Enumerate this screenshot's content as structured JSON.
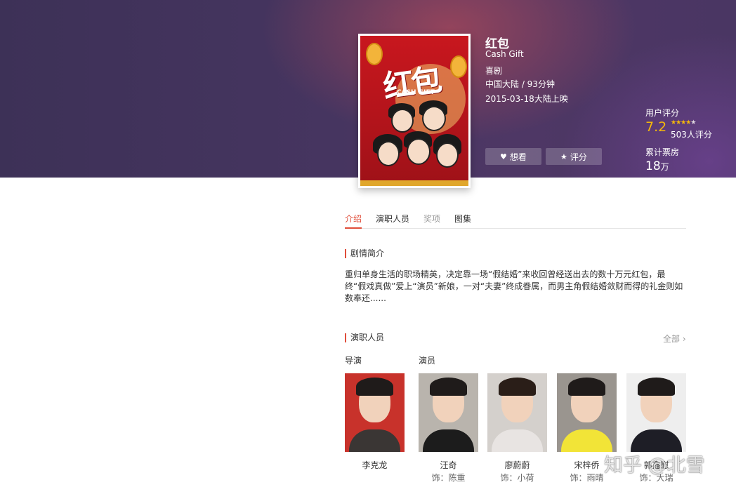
{
  "movie": {
    "title": "红包",
    "en_title": "Cash Gift",
    "genre": "喜剧",
    "region_runtime": "中国大陆 / 93分钟",
    "release": "2015-03-18大陆上映",
    "poster": {
      "title": "红包",
      "subtitle": "CASH GIFT"
    }
  },
  "actions": {
    "want_label": "想看",
    "rate_label": "评分"
  },
  "rating": {
    "label": "用户评分",
    "score": "7.2",
    "stars_filled": 4,
    "stars_total": 5,
    "count": "503人评分",
    "star_color": "#f6b80a"
  },
  "box_office": {
    "label": "累计票房",
    "value": "18",
    "unit": "万"
  },
  "tabs": [
    {
      "label": "介绍",
      "active": true
    },
    {
      "label": "演职人员",
      "active": false
    },
    {
      "label": "奖项",
      "active": false
    },
    {
      "label": "图集",
      "active": false
    }
  ],
  "synopsis": {
    "title": "剧情简介",
    "text": "重归单身生活的职场精英，决定靠一场“假结婚”来收回曾经送出去的数十万元红包，最终“假戏真做”爱上“演员”新娘，一对“夫妻”终成眷属，而男主角假结婚敛财而得的礼金则如数奉还......"
  },
  "cast_section": {
    "title": "演职人员",
    "all_label": "全部",
    "director_label": "导演",
    "actors_label": "演员"
  },
  "cast": [
    {
      "name": "李克龙",
      "role": ""
    },
    {
      "name": "汪奇",
      "role": "饰：陈重"
    },
    {
      "name": "廖蔚蔚",
      "role": "饰：小荷"
    },
    {
      "name": "宋梓侨",
      "role": "饰：雨晴"
    },
    {
      "name": "郭鑫慰",
      "role": "饰：大瑞"
    }
  ],
  "accent_color": "#e04d3a",
  "watermark": "知乎 @北雪"
}
